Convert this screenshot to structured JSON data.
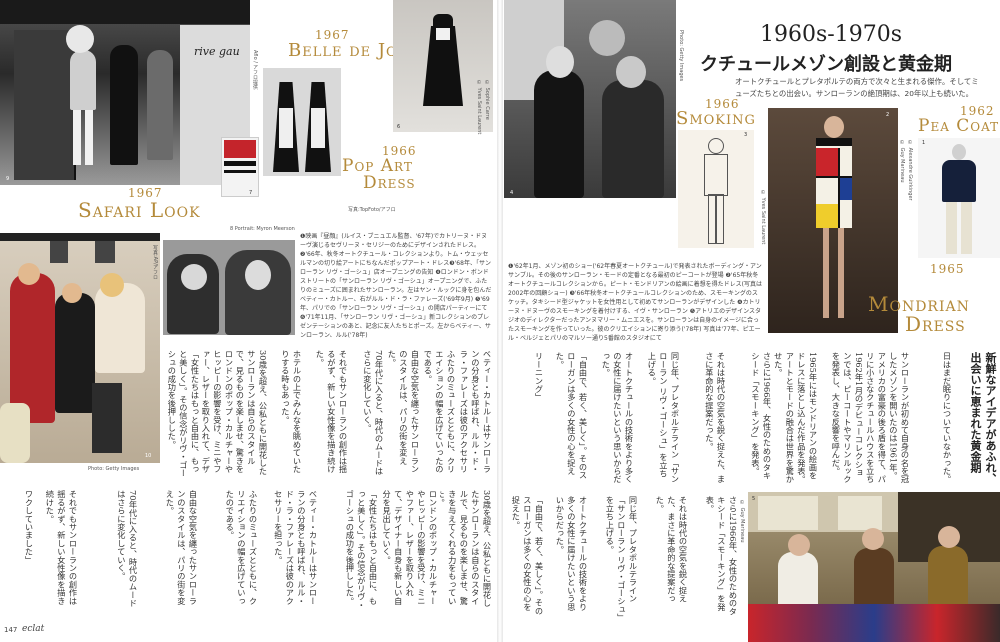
{
  "left": {
    "belle_year": "1967",
    "belle_title": "Belle de Jour",
    "popart_year": "1966",
    "popart_title_1": "Pop Art",
    "popart_title_2": "Dress",
    "safari_year": "1967",
    "safari_title": "Safari Look",
    "belle_credit_1": "© Yves Saint Laurent",
    "belle_credit_2": "© Sophie Carre",
    "popart_credit": "写真:TopFoto/アフロ",
    "agency_credit": "Aflo / アフロ提供",
    "portrait_credit": "8  Portrait: Myron Meerson",
    "afro_credit": "写真:AP/アフロ",
    "getty_credit": "Photo: Getty Images",
    "caption": "❶映画『昼顔』(ルイス・ブニュエル監督、'67年)でカトリーヌ・ドヌーヴ演じるセヴリーヌ・セリジーのためにデザインされたドレス。❷'66年、秋冬オートクチュール・コレクションより。トム・ウェッセルマンの切り絵アートにちなんだポップアート・ドレス❸'68年、「サンローラン リヴ・ゴーシュ」店オープニングの告知 ❹ロンドン・ボンドストリートの「サンローラン リヴ・ゴーシュ」オープニングで、ふたりのミューズに囲まれたサンローラン。左はヤン・ルックに身を包んだベティー・カトルー、右がルル・ド・ラ・ファレーズ('69年9月) ❺'69年、パリでの「サンローラン リヴ・ゴーシュ」の開店パーティーにて ❻'71年11月、「サンローラン リヴ・ゴーシュ」新コレクションのプレゼンテーションのあと、記念に友人たちとポーズ。左からベティー、サンローラン、ルル('78年)",
    "page_number": "147",
    "magazine": "eclat",
    "col_1": "ホテルの上でみんなを眺めていたりする時もあった。",
    "col_2": "30歳を超え、公私ともに開花したサンローランは自らのスタイルで、見るものを楽しませ、驚きを与えてくれる力をもっていた。",
    "col_3": "ロンドンのポップ・カルチャーやヒッピーの影響を受け、ミニやファー、レザーを取り入れて、デザイナー自身も新しい自分を見出していく。",
    "col_4": "「女性たちはもっと自由に、もっと美しく」。その信念がリヴ・ゴーシュの成功を後押しした。",
    "col_5": "ベティー・カトルーはサンローランの分身とも呼ばれ、ルル・ド・ラ・ファレーズは彼のアクセサリーを担った。",
    "col_6": "ふたりのミューズとともに、クリエイションの幅を広げていったのである。",
    "col_7": "自由な空気を纏ったサンローランのスタイルは、パリの街を変えた。",
    "col_8": "70年代に入ると、時代のムードはさらに変化していく。",
    "col_9": "それでもサンローランの創作は揺るがず、新しい女性像を描き続けた。",
    "col_10": "ワクしていました」"
  },
  "right": {
    "era": "1960s-1970s",
    "headline": "クチュールメゾン創設と黄金期",
    "lead": "オートクチュールとプレタポルテの両方で次々と生まれる傑作。そしてミューズたちとの出会い。サンローランの絶頂期は、20年以上も続いた。",
    "smoking_year": "1966",
    "smoking_title": "Smoking",
    "peacoat_year": "1962",
    "peacoat_title": "Pea Coat",
    "mondrian_year": "1965",
    "mondrian_title_1": "Mondrian",
    "mondrian_title_2": "Dress",
    "getty_credit": "Photo: Getty Images",
    "ysl_credit": "© Yves Saint Laurent",
    "guy_credit": "© Guy Marineau",
    "alex_credit": "© Alexandre Guirkinger",
    "guy_credit_2": "© Guy Marineau",
    "caption": "❶'62年1月、メゾン初のショー('62年春夏オートクチュール)で発表されたボーディング・アンサンブル。その後のサンローラン・モードの定番となる最初のピーコートが登場 ❷'65年秋冬オートクチュールコレクションから。ピート・モンドリアンの絵画に着想を得たドレス(写真は2002年の回顧ショー) ❸'66年秋冬オートクチュールコレクションのため、スモーキングのスケッチ。タキシード型ジャケットを女性用として初めてサンローランがデザインした ❹カトリーヌ・ドヌーヴのスモーキングを着付けする、イヴ・サンローラン ❺アトリエのデザインスタジオのディレクターだったアンヌマリー・ムニエスを。サンローランは自身のイメージに合ったスモーキングを作っていった。彼のクリエイションに寄り添う('78年) 写真は'77年、ピエール・ベルジェとパリのマルソー通り5番館のスタジオにて",
    "headline_v": "新鮮なアイデアがあふれ、出会いに恵まれた黄金期",
    "col_1": "日はまだ眠りについていなかった。",
    "col_2": "サンローランが初めて自身の名を冠したメゾンを開いたのは1961年。アメリカの富豪の後ろ盾を得て、パリに小さなクチュールハウスを立ち上げた。",
    "col_3": "1962年1月のデビューコレクションでは、ピーコートやマリンルックを発表し、大きな反響を呼んだ。",
    "col_4": "1965年にはモンドリアンの絵画をドレスに落とし込んだ作品を発表。アートとモードの融合は世界を驚かせた。",
    "col_5": "さらに1966年、女性のためのタキシード「スモーキング」を発表。",
    "col_6": "それは時代の空気を鋭く捉えた、まさに革命的な提案だった。",
    "col_7": "同じ年、プレタポルテライン「サンローラン リヴ・ゴーシュ」を立ち上げる。",
    "col_8": "オートクチュールの技術をより多くの女性に届けたいという思いからだった。",
    "col_9": "「自由で、若く、美しく」。そのスローガンは多くの女性の心を捉えた。",
    "col_10": "リーニング」"
  }
}
